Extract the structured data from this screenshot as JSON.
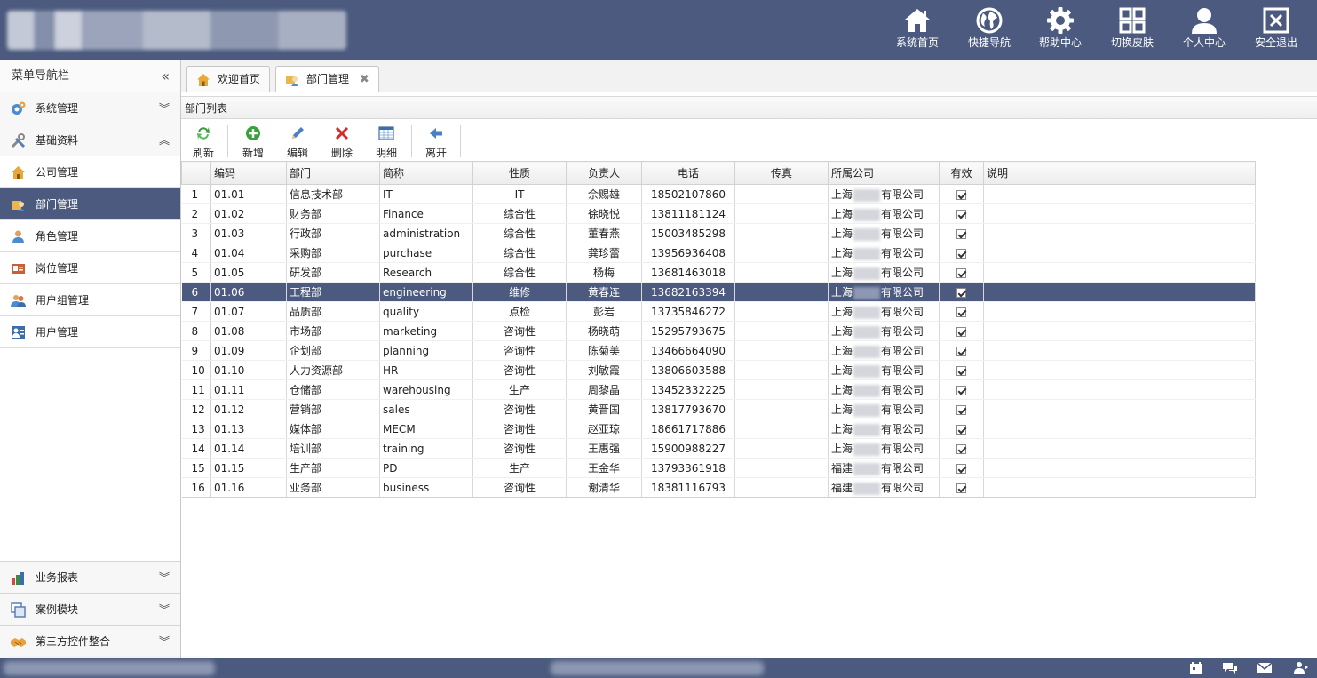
{
  "header": {
    "buttons": [
      {
        "label": "系统首页",
        "icon": "home-icon"
      },
      {
        "label": "快捷导航",
        "icon": "globe-icon"
      },
      {
        "label": "帮助中心",
        "icon": "gear-icon"
      },
      {
        "label": "切换皮肤",
        "icon": "grid-icon"
      },
      {
        "label": "个人中心",
        "icon": "user-icon"
      },
      {
        "label": "安全退出",
        "icon": "exit-icon"
      }
    ]
  },
  "sidebar": {
    "title": "菜单导航栏",
    "collapse_symbol": "«",
    "groups_top": [
      {
        "label": "系统管理",
        "expanded": false
      },
      {
        "label": "基础资料",
        "expanded": true
      }
    ],
    "items": [
      {
        "label": "公司管理",
        "active": false
      },
      {
        "label": "部门管理",
        "active": true
      },
      {
        "label": "角色管理",
        "active": false
      },
      {
        "label": "岗位管理",
        "active": false
      },
      {
        "label": "用户组管理",
        "active": false
      },
      {
        "label": "用户管理",
        "active": false
      }
    ],
    "groups_bottom": [
      {
        "label": "业务报表"
      },
      {
        "label": "案例模块"
      },
      {
        "label": "第三方控件整合"
      }
    ]
  },
  "tabs": [
    {
      "label": "欢迎首页",
      "closable": false
    },
    {
      "label": "部门管理",
      "closable": true,
      "close_symbol": "✖"
    }
  ],
  "panel": {
    "title": "部门列表",
    "toolbar": [
      "刷新",
      "新增",
      "编辑",
      "删除",
      "明细",
      "离开"
    ]
  },
  "grid": {
    "columns": [
      "编码",
      "部门",
      "简称",
      "性质",
      "负责人",
      "电话",
      "传真",
      "所属公司",
      "有效",
      "说明"
    ],
    "selected_row": 6,
    "rows": [
      {
        "n": "1",
        "code": "01.01",
        "dept": "信息技术部",
        "abbr": "IT",
        "nature": "IT",
        "head": "佘赐雄",
        "phone": "18502107860",
        "fax": "",
        "co_pre": "上海",
        "co_suf": "有限公司",
        "valid": true,
        "note": ""
      },
      {
        "n": "2",
        "code": "01.02",
        "dept": "财务部",
        "abbr": "Finance",
        "nature": "综合性",
        "head": "徐晓悦",
        "phone": "13811181124",
        "fax": "",
        "co_pre": "上海",
        "co_suf": "有限公司",
        "valid": true,
        "note": ""
      },
      {
        "n": "3",
        "code": "01.03",
        "dept": "行政部",
        "abbr": "administration",
        "nature": "综合性",
        "head": "董春燕",
        "phone": "15003485298",
        "fax": "",
        "co_pre": "上海",
        "co_suf": "有限公司",
        "valid": true,
        "note": ""
      },
      {
        "n": "4",
        "code": "01.04",
        "dept": "采购部",
        "abbr": "purchase",
        "nature": "综合性",
        "head": "龚珍蕾",
        "phone": "13956936408",
        "fax": "",
        "co_pre": "上海",
        "co_suf": "有限公司",
        "valid": true,
        "note": ""
      },
      {
        "n": "5",
        "code": "01.05",
        "dept": "研发部",
        "abbr": "Research",
        "nature": "综合性",
        "head": "杨梅",
        "phone": "13681463018",
        "fax": "",
        "co_pre": "上海",
        "co_suf": "有限公司",
        "valid": true,
        "note": ""
      },
      {
        "n": "6",
        "code": "01.06",
        "dept": "工程部",
        "abbr": "engineering",
        "nature": "维修",
        "head": "黄春连",
        "phone": "13682163394",
        "fax": "",
        "co_pre": "上海",
        "co_suf": "有限公司",
        "valid": true,
        "note": ""
      },
      {
        "n": "7",
        "code": "01.07",
        "dept": "品质部",
        "abbr": "quality",
        "nature": "点检",
        "head": "彭岩",
        "phone": "13735846272",
        "fax": "",
        "co_pre": "上海",
        "co_suf": "有限公司",
        "valid": true,
        "note": ""
      },
      {
        "n": "8",
        "code": "01.08",
        "dept": "市场部",
        "abbr": "marketing",
        "nature": "咨询性",
        "head": "杨晓萌",
        "phone": "15295793675",
        "fax": "",
        "co_pre": "上海",
        "co_suf": "有限公司",
        "valid": true,
        "note": ""
      },
      {
        "n": "9",
        "code": "01.09",
        "dept": "企划部",
        "abbr": "planning",
        "nature": "咨询性",
        "head": "陈菊美",
        "phone": "13466664090",
        "fax": "",
        "co_pre": "上海",
        "co_suf": "有限公司",
        "valid": true,
        "note": ""
      },
      {
        "n": "10",
        "code": "01.10",
        "dept": "人力资源部",
        "abbr": "HR",
        "nature": "咨询性",
        "head": "刘敏霞",
        "phone": "13806603588",
        "fax": "",
        "co_pre": "上海",
        "co_suf": "有限公司",
        "valid": true,
        "note": ""
      },
      {
        "n": "11",
        "code": "01.11",
        "dept": "仓储部",
        "abbr": "warehousing",
        "nature": "生产",
        "head": "周黎晶",
        "phone": "13452332225",
        "fax": "",
        "co_pre": "上海",
        "co_suf": "有限公司",
        "valid": true,
        "note": ""
      },
      {
        "n": "12",
        "code": "01.12",
        "dept": "营销部",
        "abbr": "sales",
        "nature": "咨询性",
        "head": "黄晋国",
        "phone": "13817793670",
        "fax": "",
        "co_pre": "上海",
        "co_suf": "有限公司",
        "valid": true,
        "note": ""
      },
      {
        "n": "13",
        "code": "01.13",
        "dept": "媒体部",
        "abbr": "MECM",
        "nature": "咨询性",
        "head": "赵亚琼",
        "phone": "18661717886",
        "fax": "",
        "co_pre": "上海",
        "co_suf": "有限公司",
        "valid": true,
        "note": ""
      },
      {
        "n": "14",
        "code": "01.14",
        "dept": "培训部",
        "abbr": "training",
        "nature": "咨询性",
        "head": "王惠强",
        "phone": "15900988227",
        "fax": "",
        "co_pre": "上海",
        "co_suf": "有限公司",
        "valid": true,
        "note": ""
      },
      {
        "n": "15",
        "code": "01.15",
        "dept": "生产部",
        "abbr": "PD",
        "nature": "生产",
        "head": "王金华",
        "phone": "13793361918",
        "fax": "",
        "co_pre": "福建",
        "co_suf": "有限公司",
        "valid": true,
        "note": ""
      },
      {
        "n": "16",
        "code": "01.16",
        "dept": "业务部",
        "abbr": "business",
        "nature": "咨询性",
        "head": "谢清华",
        "phone": "18381116793",
        "fax": "",
        "co_pre": "福建",
        "co_suf": "有限公司",
        "valid": true,
        "note": ""
      }
    ]
  },
  "footer": {
    "icons": [
      "calendar-icon",
      "chat-icon",
      "mail-icon",
      "user-share-icon"
    ]
  },
  "colors": {
    "header_bg": "#4b5a7e",
    "selected_row_bg": "#4b5a7e"
  }
}
